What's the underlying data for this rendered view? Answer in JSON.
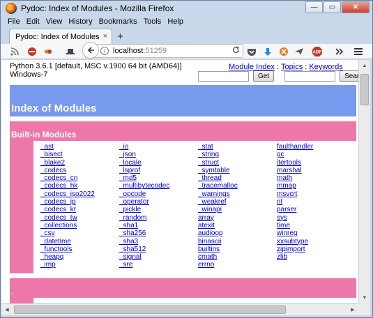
{
  "window": {
    "title": "Pydoc: Index of Modules - Mozilla Firefox",
    "minimize_glyph": "—",
    "maximize_glyph": "▭",
    "close_glyph": "✕"
  },
  "menubar": {
    "items": [
      "File",
      "Edit",
      "View",
      "History",
      "Bookmarks",
      "Tools",
      "Help"
    ]
  },
  "tabs": [
    {
      "label": "Pydoc: Index of Modules",
      "close_glyph": "×"
    }
  ],
  "newtab_glyph": "+",
  "toolbar": {
    "url_host": "localhost",
    "url_port": ":51259",
    "icons": [
      "rss-icon",
      "ublock-icon",
      "addon-icon",
      "hat-icon",
      "back-icon",
      "reload-icon",
      "pocket-icon",
      "download-icon",
      "addon2-icon",
      "send-icon",
      "abp-icon",
      "overflow-icon",
      "menu-icon"
    ]
  },
  "page": {
    "python_version": "Python 3.6.1 [default, MSC v.1900 64 bit (AMD64)]",
    "os": "Windows-7",
    "links": {
      "module_index": "Module Index",
      "sep1": " : ",
      "topics": "Topics",
      "sep2": " : ",
      "keywords": "Keywords"
    },
    "get_button": "Get",
    "search_button": "Search",
    "heading": "Index of Modules",
    "section_title": "Built-in Modules",
    "second_section_title": ".",
    "modules": [
      [
        "_ast",
        "_bisect",
        "_blake2",
        "_codecs",
        "_codecs_cn",
        "_codecs_hk",
        "_codecs_iso2022",
        "_codecs_jp",
        "_codecs_kr",
        "_codecs_tw",
        "_collections",
        "_csv",
        "_datetime",
        "_functools",
        "_heapq",
        "_imp"
      ],
      [
        "_io",
        "_json",
        "_locale",
        "_lsprof",
        "_md5",
        "_multibytecodec",
        "_opcode",
        "_operator",
        "_pickle",
        "_random",
        "_sha1",
        "_sha256",
        "_sha3",
        "_sha512",
        "_signal",
        "_sre"
      ],
      [
        "_stat",
        "_string",
        "_struct",
        "_symtable",
        "_thread",
        "_tracemalloc",
        "_warnings",
        "_weakref",
        "_winapi",
        "array",
        "atexit",
        "audioop",
        "binascii",
        "builtins",
        "cmath",
        "errno"
      ],
      [
        "faulthandler",
        "gc",
        "itertools",
        "marshal",
        "math",
        "mmap",
        "msvcrt",
        "nt",
        "parser",
        "sys",
        "time",
        "winreg",
        "xxsubtype",
        "zipimport",
        "zlib"
      ]
    ]
  },
  "colors": {
    "heading_blue": "#7799ee",
    "section_pink": "#ee77aa",
    "link": "#0000cc"
  }
}
